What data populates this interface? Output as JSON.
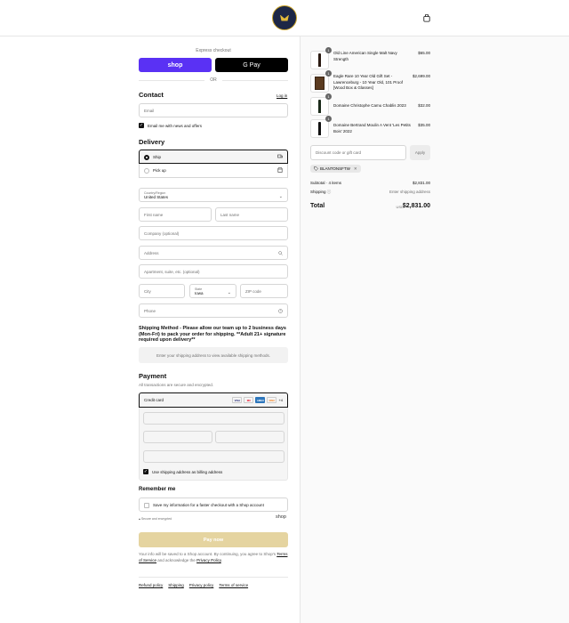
{
  "header": {
    "logo_icon": "brand-logo-icon",
    "cart_icon": "shopping-bag-icon"
  },
  "express": {
    "label": "Express checkout",
    "shop_pay": "shop",
    "gpay": "G Pay",
    "or": "OR"
  },
  "contact": {
    "title": "Contact",
    "login": "Log in",
    "email_placeholder": "Email",
    "news_label": "Email me with news and offers",
    "news_checked": true
  },
  "delivery": {
    "title": "Delivery",
    "ship": "Ship",
    "pickup": "Pick up",
    "country_label": "Country/Region",
    "country_value": "United States",
    "first_name": "First name",
    "last_name": "Last name",
    "company": "Company (optional)",
    "address": "Address",
    "apartment": "Apartment, suite, etc. (optional)",
    "city": "City",
    "state_label": "State",
    "state_value": "Iowa",
    "zip": "ZIP code",
    "phone": "Phone"
  },
  "shipping_notice": "Shipping Method - Please allow our team up to 2 business days (Mon-Fri) to pack your order for shipping. **Adult 21+ signature required upon delivery**",
  "shipping_methods_placeholder": "Enter your shipping address to view available shipping methods.",
  "payment": {
    "title": "Payment",
    "subtitle": "All transactions are secure and encrypted.",
    "credit_card": "Credit card",
    "card_logos": [
      "VISA",
      "MC",
      "AMEX",
      "DISC"
    ],
    "more_cards": "+4",
    "billing_label": "Use shipping address as billing address"
  },
  "remember": {
    "title": "Remember me",
    "label": "Save my information for a faster checkout with a Shop account",
    "secure": "Secure and encrypted",
    "shop": "shop"
  },
  "pay_now": "Pay now",
  "legal": {
    "text1": "Your info will be saved to a Shop account. By continuing, you agree to Shop's ",
    "terms": "Terms of Service",
    "text2": " and acknowledge the ",
    "privacy": "Privacy Policy",
    "text3": "."
  },
  "footer_links": [
    "Refund policy",
    "Shipping",
    "Privacy policy",
    "Terms of service"
  ],
  "cart": {
    "items": [
      {
        "qty": "1",
        "name": "Old Line American Single Malt Navy Strength",
        "price": "$65.00"
      },
      {
        "qty": "1",
        "name": "Eagle Rare 10 Year Old Gift Set - Lawrenceburg - 10 Year Old, 101 Proof [Wood Box & Glasses]",
        "price": "$2,699.00"
      },
      {
        "qty": "1",
        "name": "Domaine Christophe Camu Chablis 2023",
        "price": "$32.00"
      },
      {
        "qty": "1",
        "name": "Domaine Bertrand Moulin A Vent 'Les Petits Bois' 2022",
        "price": "$35.00"
      }
    ],
    "discount_placeholder": "Discount code or gift card",
    "apply": "Apply",
    "applied_code": "BLANTONSFTW",
    "subtotal_label": "Subtotal · 4 items",
    "subtotal": "$2,831.00",
    "shipping_label": "Shipping",
    "shipping_value": "Enter shipping address",
    "total_label": "Total",
    "currency": "USD",
    "total": "$2,831.00"
  }
}
